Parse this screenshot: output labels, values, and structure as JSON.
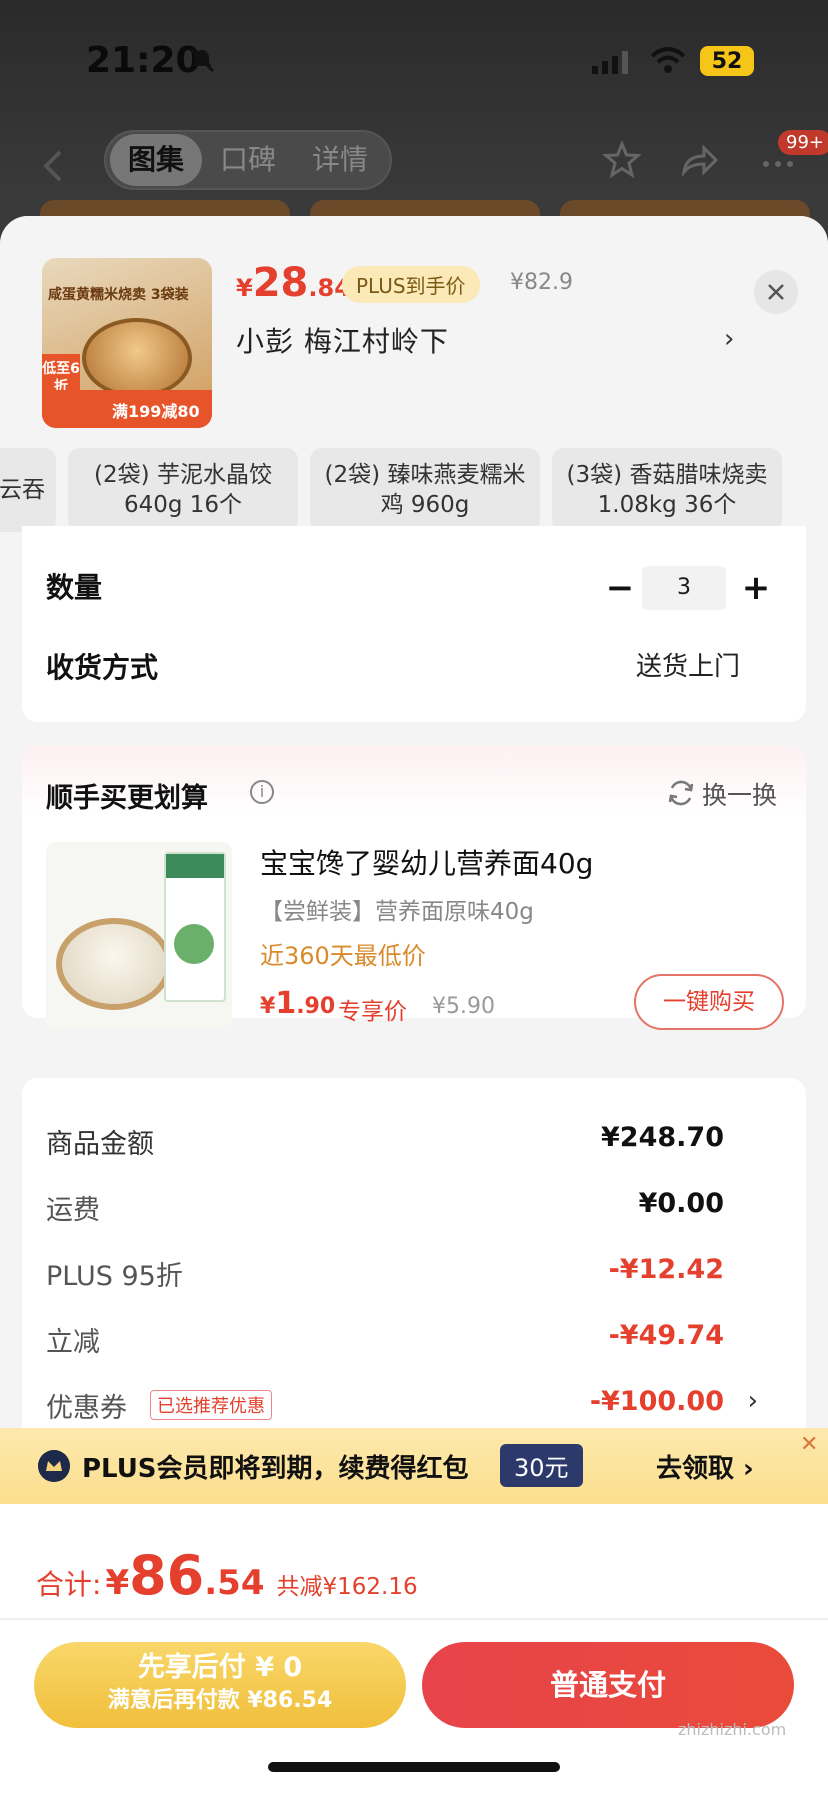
{
  "status": {
    "time": "21:20",
    "battery": "52"
  },
  "nav": {
    "tabs": [
      {
        "label": "图集"
      },
      {
        "label": "口碑"
      },
      {
        "label": "详情"
      }
    ],
    "badge": "99+"
  },
  "header": {
    "price_yen": "¥",
    "price_int": "28",
    "price_dec": ".84",
    "plus_chip": "PLUS到手价",
    "orig_price": "¥82.9",
    "address": "小彭  梅江村岭下",
    "thumb": {
      "tag": "低至6折",
      "promo": "满199减80",
      "title": "咸蛋黄糯米烧卖 3袋装"
    }
  },
  "variants": [
    {
      "line1": "云吞",
      "line2": ""
    },
    {
      "line1": "(2袋) 芋泥水晶饺",
      "line2": "640g 16个"
    },
    {
      "line1": "(2袋) 臻味燕麦糯米",
      "line2": "鸡 960g"
    },
    {
      "line1": "(3袋) 香菇腊味烧卖",
      "line2": "1.08kg 36个"
    }
  ],
  "quantity": {
    "label": "数量",
    "value": "3",
    "minus": "−",
    "plus": "+"
  },
  "delivery": {
    "label": "收货方式",
    "value": "送货上门"
  },
  "addon": {
    "title": "顺手买更划算",
    "refresh": "换一换",
    "name": "宝宝馋了婴幼儿营养面40g",
    "spec": "【尝鲜装】营养面原味40g",
    "lowest": "近360天最低价",
    "price_yen": "¥",
    "price_int": "1",
    "price_dec": ".90",
    "exclusive": "专享价",
    "orig": "¥5.90",
    "buy": "一键购买"
  },
  "summary": [
    {
      "label": "商品金额",
      "value": "¥248.70",
      "red": false
    },
    {
      "label": "运费",
      "value": "¥0.00",
      "red": false
    },
    {
      "label": "PLUS 95折",
      "value": "-¥12.42",
      "red": true
    },
    {
      "label": "立减",
      "value": "-¥49.74",
      "red": true
    },
    {
      "label": "优惠券",
      "value": "-¥100.00",
      "red": true,
      "chip": "已选推荐优惠"
    }
  ],
  "plus_banner": {
    "text": "PLUS会员即将到期，续费得红包",
    "amount": "30元",
    "claim": "去领取 ›"
  },
  "total": {
    "label": "合计:",
    "yen": "¥",
    "int": "86",
    "dec": ".54",
    "saved": "共减¥162.16"
  },
  "later_pay": {
    "title": "先享后付 ¥ 0",
    "sub": "满意后再付款 ¥86.54"
  },
  "pay": {
    "label": "普通支付"
  },
  "watermark": "zhizhizhi.com",
  "colors": {
    "accent": "#e53f2e",
    "plus_gold": "#fcdf8d",
    "later_gold": "#f1bf3c"
  }
}
